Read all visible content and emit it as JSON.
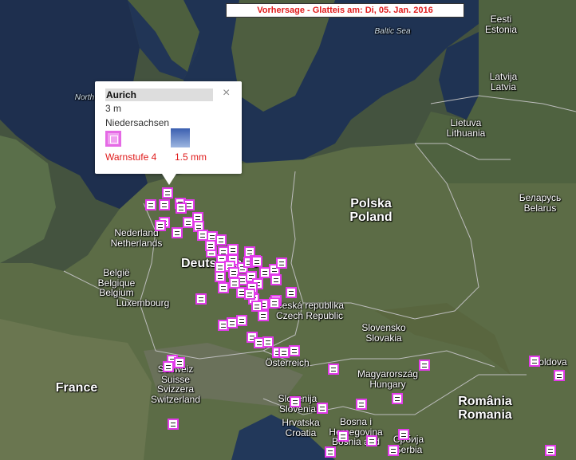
{
  "banner": "Vorhersage - Glatteis am: Di, 05. Jan. 2016",
  "popup": {
    "title": "Aurich",
    "elevation": "3 m",
    "region": "Niedersachsen",
    "warning_level": "Warnstufe 4",
    "precip": "1.5  mm",
    "close": "×",
    "warn_icon": "warning-level-icon",
    "weather_icon": "weather-ice-icon"
  },
  "labels": {
    "eesti": "Eesti",
    "estonia": "Estonia",
    "baltic": "Baltic Sea",
    "latvija": "Latvija",
    "latvia": "Latvia",
    "lietuva": "Lietuva",
    "lithuania": "Lithuania",
    "north": "North",
    "belarus1": "Беларусь",
    "belarus2": "Belarus",
    "polska": "Polska",
    "poland": "Poland",
    "nl1": "Nederland",
    "nl2": "Netherlands",
    "de": "Deutschland",
    "be1": "België",
    "be2": "Belgique",
    "be3": "Belgium",
    "lux": "Luxembourg",
    "cz1": "Česká republika",
    "cz2": "Czech Republic",
    "sk1": "Slovensko",
    "sk2": "Slovakia",
    "at": "Österreich",
    "hu1": "Magyarország",
    "hu2": "Hungary",
    "moldova": "Moldova",
    "france": "France",
    "ch1": "Schweiz",
    "ch2": "Suisse",
    "ch3": "Svizzera",
    "ch4": "Switzerland",
    "si1": "Slovenija",
    "si2": "Slovenia",
    "hr1": "Hrvatska",
    "hr2": "Croatia",
    "ba1": "Bosna i",
    "ba2": "Hercegovina",
    "ba3": "Bosnia and",
    "rs1": "Србија",
    "rs2": "Serbia",
    "ro1": "România",
    "ro2": "Romania"
  },
  "colors": {
    "marker_border": "#e23bea",
    "warning_text": "#e01b1b"
  },
  "marker_count": 77
}
